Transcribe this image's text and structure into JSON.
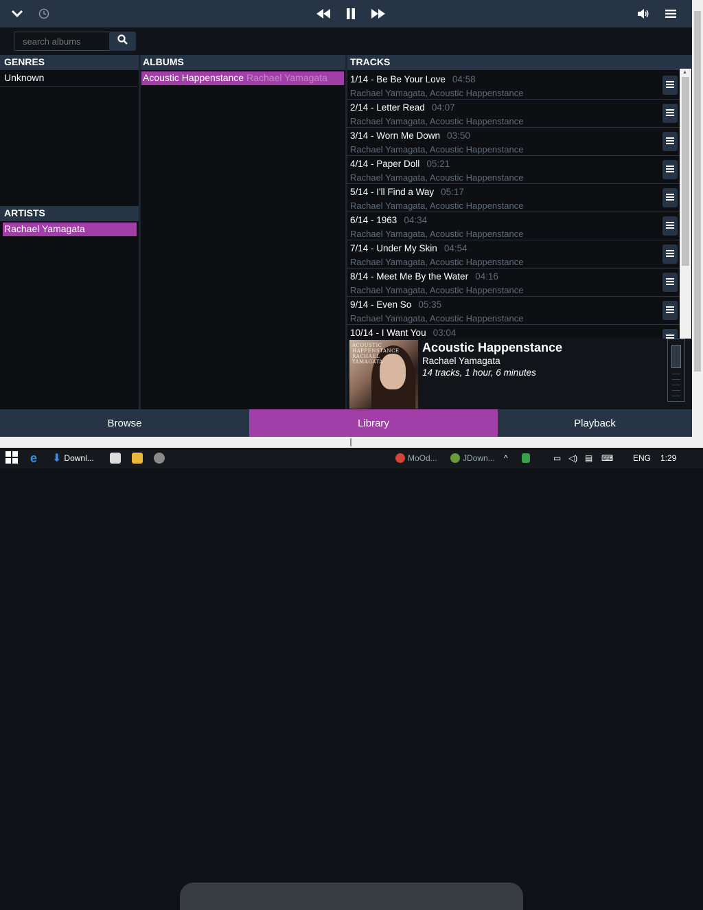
{
  "search": {
    "placeholder": "search albums"
  },
  "headers": {
    "genres": "GENRES",
    "albums": "ALBUMS",
    "tracks": "TRACKS",
    "artists": "ARTISTS"
  },
  "genres": [
    "Unknown"
  ],
  "artists": [
    {
      "name": "Rachael Yamagata",
      "selected": true
    }
  ],
  "albums": [
    {
      "title": "Acoustic Happenstance",
      "artist": "Rachael Yamagata",
      "selected": true
    }
  ],
  "tracks": [
    {
      "title": "1/14 - Be Be Your Love",
      "duration": "04:58",
      "sub": "Rachael Yamagata, Acoustic Happenstance"
    },
    {
      "title": "2/14 - Letter Read",
      "duration": "04:07",
      "sub": "Rachael Yamagata, Acoustic Happenstance"
    },
    {
      "title": "3/14 - Worn Me Down",
      "duration": "03:50",
      "sub": "Rachael Yamagata, Acoustic Happenstance"
    },
    {
      "title": "4/14 - Paper Doll",
      "duration": "05:21",
      "sub": "Rachael Yamagata, Acoustic Happenstance"
    },
    {
      "title": "5/14 - I'll Find a Way",
      "duration": "05:17",
      "sub": "Rachael Yamagata, Acoustic Happenstance"
    },
    {
      "title": "6/14 - 1963",
      "duration": "04:34",
      "sub": "Rachael Yamagata, Acoustic Happenstance"
    },
    {
      "title": "7/14 - Under My Skin",
      "duration": "04:54",
      "sub": "Rachael Yamagata, Acoustic Happenstance"
    },
    {
      "title": "8/14 - Meet Me By the Water",
      "duration": "04:16",
      "sub": "Rachael Yamagata, Acoustic Happenstance"
    },
    {
      "title": "9/14 - Even So",
      "duration": "05:35",
      "sub": "Rachael Yamagata, Acoustic Happenstance"
    },
    {
      "title": "10/14 - I Want You",
      "duration": "03:04",
      "sub": ""
    }
  ],
  "nowplaying": {
    "album": "Acoustic Happenstance",
    "artist": "Rachael Yamagata",
    "info": "14 tracks, 1 hour, 6 minutes",
    "cover_text": "ACOUSTIC HAPPENSTANCE RACHAEL YAMAGATA"
  },
  "nav": {
    "browse": "Browse",
    "library": "Library",
    "playback": "Playback"
  },
  "taskbar": {
    "item1": "Downl...",
    "item2": "MoOd...",
    "item3": "JDown...",
    "lang": "ENG",
    "time": "1:29"
  },
  "colors": {
    "accent": "#a13ea8",
    "bar": "#263445",
    "dim_text": "#5f6b78"
  }
}
